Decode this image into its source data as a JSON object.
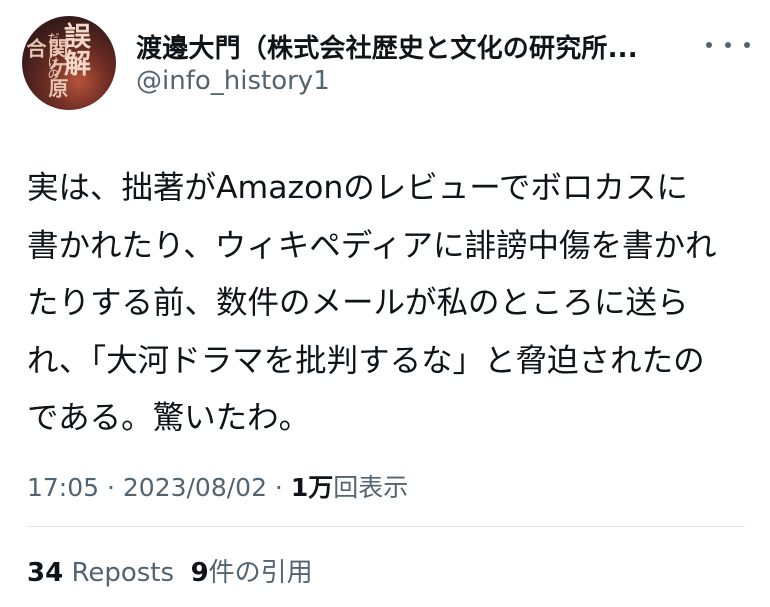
{
  "author": {
    "display_name": "渡邊大門（株式会社歴史と文化の研究所...",
    "handle": "@info_history1",
    "avatar_text": {
      "title": "誤解",
      "subtitle": "だらけの",
      "side": "関ケ原合"
    }
  },
  "tweet": {
    "lines": [
      "実は、拙著がAmazonのレビューでボロカスに",
      "書かれたり、ウィキペディアに誹謗中傷を書かれ",
      "たりする前、数件のメールが私のところに送ら",
      "れ、「大河ドラマを批判するな」と脅迫されたの",
      "である。驚いたわ。"
    ]
  },
  "meta": {
    "time": "17:05",
    "sep1": " · ",
    "date": "2023/08/02",
    "sep2": " · ",
    "views_count": "1万",
    "views_label": "回表示"
  },
  "stats": {
    "reposts_count": "34",
    "reposts_label": "Reposts",
    "quotes_count": "9",
    "quotes_label": "件の引用"
  },
  "colors": {
    "text_primary": "#0f1419",
    "text_secondary": "#536471",
    "divider": "#e1e6ea"
  }
}
